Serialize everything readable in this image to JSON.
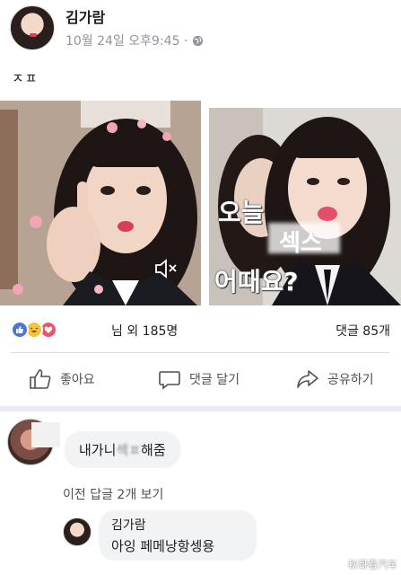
{
  "post": {
    "author": "김가람",
    "timestamp": "10월 24일 오후9:45 ·",
    "privacy_icon": "globe-icon",
    "text": "ㅈㅍ"
  },
  "photos": {
    "right_overlay": {
      "line1": "오늘",
      "line2": "섹스",
      "line3": "어때요?"
    },
    "left_icon": "sound-muted-icon"
  },
  "reactions": {
    "icons": [
      "like-icon",
      "haha-icon",
      "love-icon"
    ],
    "count_text": "님 외 185명",
    "comments_text": "댓글 85개"
  },
  "actions": {
    "like": "좋아요",
    "comment": "댓글 달기",
    "share": "공유하기"
  },
  "comments": [
    {
      "text_prefix": "내가니",
      "text_blurred": "섹ㅍ",
      "text_suffix": "해줌"
    }
  ],
  "previous_replies": "이전 답글 2개 보기",
  "reply": {
    "author": "김가람",
    "text": "아잉 페메낭항셍용"
  },
  "watermark": "秋哥看汽车",
  "colors": {
    "like_blue": "#4a76d6",
    "haha_yellow": "#f5c33b",
    "love_red": "#ed5468",
    "bubble_gray": "#f2f3f5",
    "meta_gray": "#90949c"
  }
}
